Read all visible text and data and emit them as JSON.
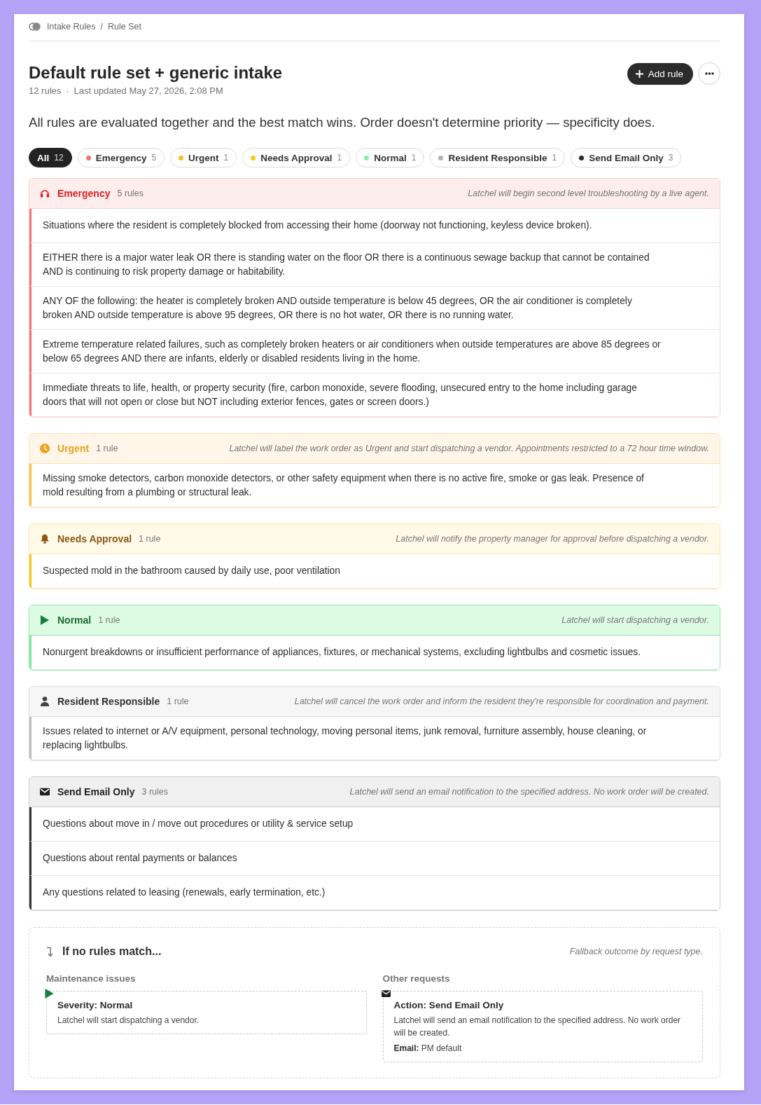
{
  "breadcrumb": {
    "items": [
      "Intake Rules",
      "Rule Set"
    ],
    "separator": "/"
  },
  "header": {
    "title": "Default rule set + generic intake",
    "rule_count": "12 rules",
    "separator": "·",
    "updated": "Last updated May 27, 2026, 2:08 PM",
    "add_button": "Add rule"
  },
  "description": "All rules are evaluated together and the best match wins. Order doesn't determine priority — specificity does.",
  "filters": [
    {
      "label": "All",
      "count": "12",
      "selected": true
    },
    {
      "label": "Emergency",
      "count": "5",
      "selected": false,
      "color": "#f87171"
    },
    {
      "label": "Urgent",
      "count": "1",
      "selected": false,
      "color": "#fbbf24"
    },
    {
      "label": "Needs Approval",
      "count": "1",
      "selected": false,
      "color": "#facc15"
    },
    {
      "label": "Normal",
      "count": "1",
      "selected": false,
      "color": "#86efac"
    },
    {
      "label": "Resident Responsible",
      "count": "1",
      "selected": false,
      "color": "#b0b0b0"
    },
    {
      "label": "Send Email Only",
      "count": "3",
      "selected": false,
      "color": "#2a2a2a"
    }
  ],
  "groups": [
    {
      "kind": "emergency",
      "title": "Emergency",
      "count": "5 rules",
      "note": "Latchel will begin second level troubleshooting by a live agent.",
      "rules": [
        "Situations where the resident is completely blocked from accessing their home (doorway not functioning, keyless device broken).",
        "EITHER there is a major water leak OR there is standing water on the floor OR there is a continuous sewage backup that cannot be contained AND is continuing to risk property damage or habitability.",
        "ANY OF the following: the heater is completely broken AND outside temperature is below 45 degrees, OR the air conditioner is completely broken AND outside temperature is above 95 degrees, OR there is no hot water, OR there is no running water.",
        "Extreme temperature related failures, such as completely broken heaters or air conditioners when outside temperatures are above 85 degrees or below 65 degrees AND there are infants, elderly or disabled residents living in the home.",
        "Immediate threats to life, health, or property security (fire, carbon monoxide, severe flooding, unsecured entry to the home including garage doors that will not open or close but NOT including exterior fences, gates or screen doors.)"
      ]
    },
    {
      "kind": "urgent",
      "title": "Urgent",
      "count": "1 rule",
      "note": "Latchel will label the work order as Urgent and start dispatching a vendor. Appointments restricted to a 72 hour time window.",
      "rules": [
        "Missing smoke detectors, carbon monoxide detectors, or other safety equipment when there is no active fire, smoke or gas leak. Presence of mold resulting from a plumbing or structural leak."
      ]
    },
    {
      "kind": "approval",
      "title": "Needs Approval",
      "count": "1 rule",
      "note": "Latchel will notify the property manager for approval before dispatching a vendor.",
      "rules": [
        "Suspected mold in the bathroom caused by daily use, poor ventilation"
      ]
    },
    {
      "kind": "normal",
      "title": "Normal",
      "count": "1 rule",
      "note": "Latchel will start dispatching a vendor.",
      "rules": [
        "Nonurgent breakdowns or insufficient performance of appliances, fixtures, or mechanical systems, excluding lightbulbs and cosmetic issues."
      ]
    },
    {
      "kind": "resident",
      "title": "Resident Responsible",
      "count": "1 rule",
      "note": "Latchel will cancel the work order and inform the resident they're responsible for coordination and payment.",
      "rules": [
        "Issues related to internet or A/V equipment, personal technology, moving personal items, junk removal, furniture assembly, house cleaning, or replacing lightbulbs."
      ]
    },
    {
      "kind": "email",
      "title": "Send Email Only",
      "count": "3 rules",
      "note": "Latchel will send an email notification to the specified address. No work order will be created.",
      "rules": [
        "Questions about move in / move out procedures or utility & service setup",
        "Questions about rental payments or balances",
        "Any questions related to leasing (renewals, early termination, etc.)"
      ]
    }
  ],
  "fallback": {
    "title": "If no rules match...",
    "note": "Fallback outcome by request type.",
    "columns": [
      {
        "kind": "normal",
        "heading": "Maintenance issues",
        "title": "Severity: Normal",
        "text": "Latchel will start dispatching a vendor."
      },
      {
        "kind": "email",
        "heading": "Other requests",
        "title": "Action: Send Email Only",
        "text": "Latchel will send an email notification to the specified address. No work order will be created.",
        "email": "**Email:** PM default"
      }
    ]
  }
}
